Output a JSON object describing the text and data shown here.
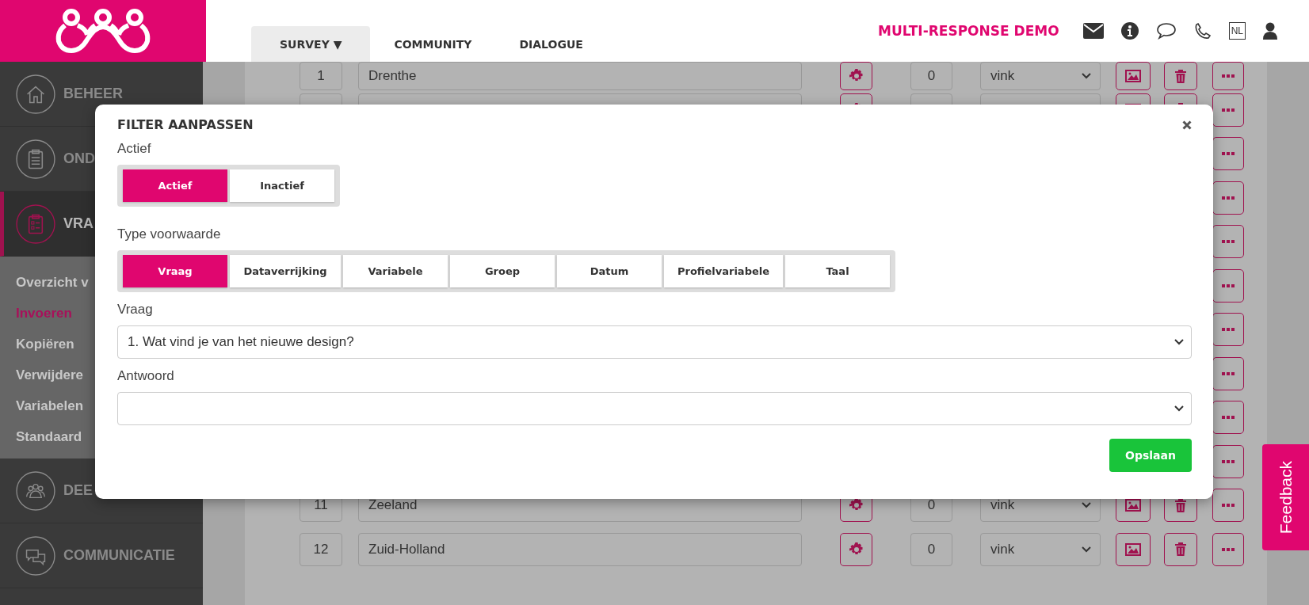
{
  "header": {
    "nav": [
      {
        "label": "SURVEY ▼",
        "selected": true
      },
      {
        "label": "COMMUNITY",
        "selected": false
      },
      {
        "label": "DIALOGUE",
        "selected": false
      }
    ],
    "brand": "MULTI-RESPONSE DEMO",
    "language": "NL"
  },
  "sidebar": {
    "items": [
      {
        "label": "BEHEER",
        "selected": false
      },
      {
        "label": "OND",
        "selected": false
      },
      {
        "label": "VRA",
        "selected": true,
        "expanded": true,
        "children": [
          {
            "label": "Overzicht v",
            "selected": false
          },
          {
            "label": "Invoeren",
            "selected": true
          },
          {
            "label": "Kopiëren",
            "selected": false
          },
          {
            "label": "Verwijdere",
            "selected": false
          },
          {
            "label": "Variabelen",
            "selected": false
          },
          {
            "label": "Standaard",
            "selected": false
          }
        ]
      },
      {
        "label": "DEE",
        "selected": false
      },
      {
        "label": "COMMUNICATIE",
        "selected": false
      }
    ]
  },
  "table": {
    "rows": [
      {
        "kind": "full",
        "number": "1",
        "name": "Drenthe",
        "count": "0",
        "type": "vink"
      },
      {
        "kind": "full"
      },
      {
        "kind": "covered"
      },
      {
        "kind": "covered"
      },
      {
        "kind": "covered"
      },
      {
        "kind": "covered"
      },
      {
        "kind": "covered"
      },
      {
        "kind": "covered"
      },
      {
        "kind": "covered"
      },
      {
        "kind": "covered"
      },
      {
        "kind": "full",
        "number": "11",
        "name": "Zeeland",
        "count": "0",
        "type": "vink"
      },
      {
        "kind": "full",
        "number": "12",
        "name": "Zuid-Holland",
        "count": "0",
        "type": "vink"
      }
    ]
  },
  "modal": {
    "title": "FILTER AANPASSEN",
    "status": {
      "label": "Actief",
      "options": [
        {
          "label": "Actief",
          "selected": true
        },
        {
          "label": "Inactief",
          "selected": false
        }
      ]
    },
    "condition_type": {
      "label": "Type voorwaarde",
      "options": [
        {
          "label": "Vraag",
          "selected": true
        },
        {
          "label": "Dataverrijking",
          "selected": false
        },
        {
          "label": "Variabele",
          "selected": false
        },
        {
          "label": "Groep",
          "selected": false
        },
        {
          "label": "Datum",
          "selected": false
        },
        {
          "label": "Profielvariabele",
          "selected": false
        },
        {
          "label": "Taal",
          "selected": false
        }
      ]
    },
    "question": {
      "label": "Vraag",
      "value": "1. Wat vind je van het nieuwe design?"
    },
    "answer": {
      "label": "Antwoord"
    },
    "save_button": "Opslaan"
  },
  "feedback": "Feedback"
}
